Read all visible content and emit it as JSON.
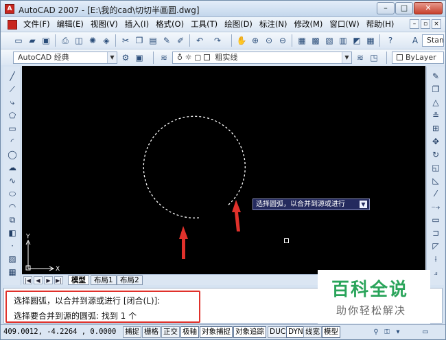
{
  "window": {
    "title": "AutoCAD 2007 - [E:\\我的cad\\切切半画圆.dwg]",
    "buttons": {
      "minimize": "–",
      "maximize": "□",
      "close": "✕"
    }
  },
  "menubar": {
    "items": [
      {
        "label": "文件(F)"
      },
      {
        "label": "编辑(E)"
      },
      {
        "label": "视图(V)"
      },
      {
        "label": "插入(I)"
      },
      {
        "label": "格式(O)"
      },
      {
        "label": "工具(T)"
      },
      {
        "label": "绘图(D)"
      },
      {
        "label": "标注(N)"
      },
      {
        "label": "修改(M)"
      },
      {
        "label": "窗口(W)"
      },
      {
        "label": "帮助(H)"
      }
    ],
    "doc_buttons": {
      "minimize": "–",
      "restore": "▫",
      "close": "×"
    }
  },
  "toolbar": {
    "style_combo_text": "Stand",
    "workspace_combo": "AutoCAD 经典",
    "layer_combo": "粗实线",
    "color_combo": "ByLayer"
  },
  "canvas": {
    "background": "#000000",
    "tooltip_text": "选择圆弧，以合并到源或进行",
    "ucs_labels": {
      "y": "Y",
      "x": "X"
    }
  },
  "layout_tabs": {
    "tabs": [
      {
        "label": "模型",
        "active": true
      },
      {
        "label": "布局1",
        "active": false
      },
      {
        "label": "布局2",
        "active": false
      }
    ]
  },
  "command": {
    "line1": "选择圆弧，以合并到源或进行 [闭合(L)]:",
    "line2": "选择要合并到源的圆弧:  找到 1 个",
    "highlight_color": "#e0312b"
  },
  "watermark": {
    "title": "百科全说",
    "subtitle": "助你轻松解决",
    "color": "#2aa45a"
  },
  "statusbar": {
    "coords": "409.0012, -4.2264 , 0.0000",
    "buttons": [
      {
        "label": "捕捉",
        "on": false
      },
      {
        "label": "栅格",
        "on": false
      },
      {
        "label": "正交",
        "on": false
      },
      {
        "label": "极轴",
        "on": true
      },
      {
        "label": "对象捕捉",
        "on": true
      },
      {
        "label": "对象追踪",
        "on": true
      },
      {
        "label": "DUCS",
        "on": false
      },
      {
        "label": "DYN",
        "on": true
      },
      {
        "label": "线宽",
        "on": false
      },
      {
        "label": "模型",
        "on": true
      }
    ]
  },
  "annotations": {
    "arrow_color": "#e0312b"
  }
}
